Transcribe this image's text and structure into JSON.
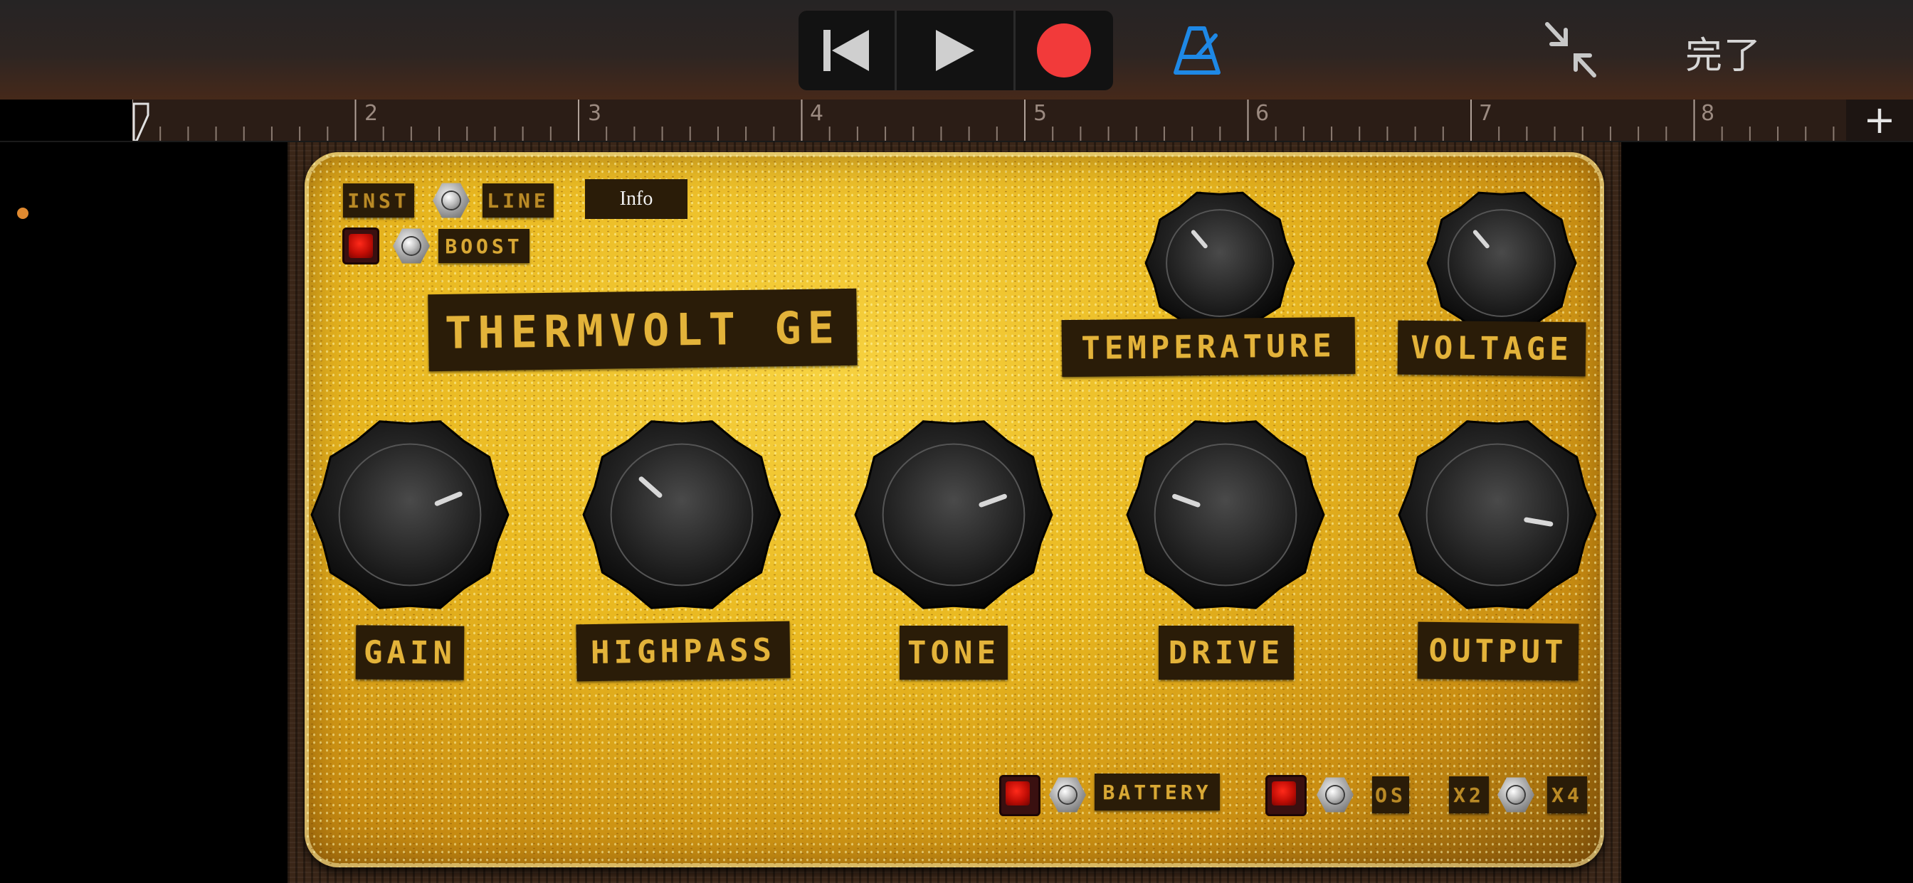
{
  "toolbar": {
    "buttons": [
      "rewind-icon",
      "play-icon",
      "record-icon",
      "metronome-icon",
      "collapse-icon"
    ],
    "record_color": "#f23a3a",
    "metronome_color": "#1e88e5",
    "done_label": "完了"
  },
  "ruler": {
    "bars": [
      "2",
      "3",
      "4",
      "5",
      "6",
      "7",
      "8"
    ],
    "add_label": "+"
  },
  "pedal": {
    "name": "THERMVOLT GE",
    "info_label": "Info",
    "input_switch": {
      "left_label": "INST",
      "right_label": "LINE"
    },
    "boost_label": "BOOST",
    "knobs": [
      {
        "label": "TEMPERATURE",
        "value": 0.35
      },
      {
        "label": "VOLTAGE",
        "value": 0.35
      },
      {
        "label": "GAIN",
        "value": 0.75
      },
      {
        "label": "HIGHPASS",
        "value": 0.32
      },
      {
        "label": "TONE",
        "value": 0.76
      },
      {
        "label": "DRIVE",
        "value": 0.24
      },
      {
        "label": "OUTPUT",
        "value": 0.87
      }
    ],
    "bottom_switches": {
      "battery_label": "BATTERY",
      "os_label": "OS",
      "x2_label": "X2",
      "x4_label": "X4"
    },
    "accent_color": "#e3b33a"
  }
}
